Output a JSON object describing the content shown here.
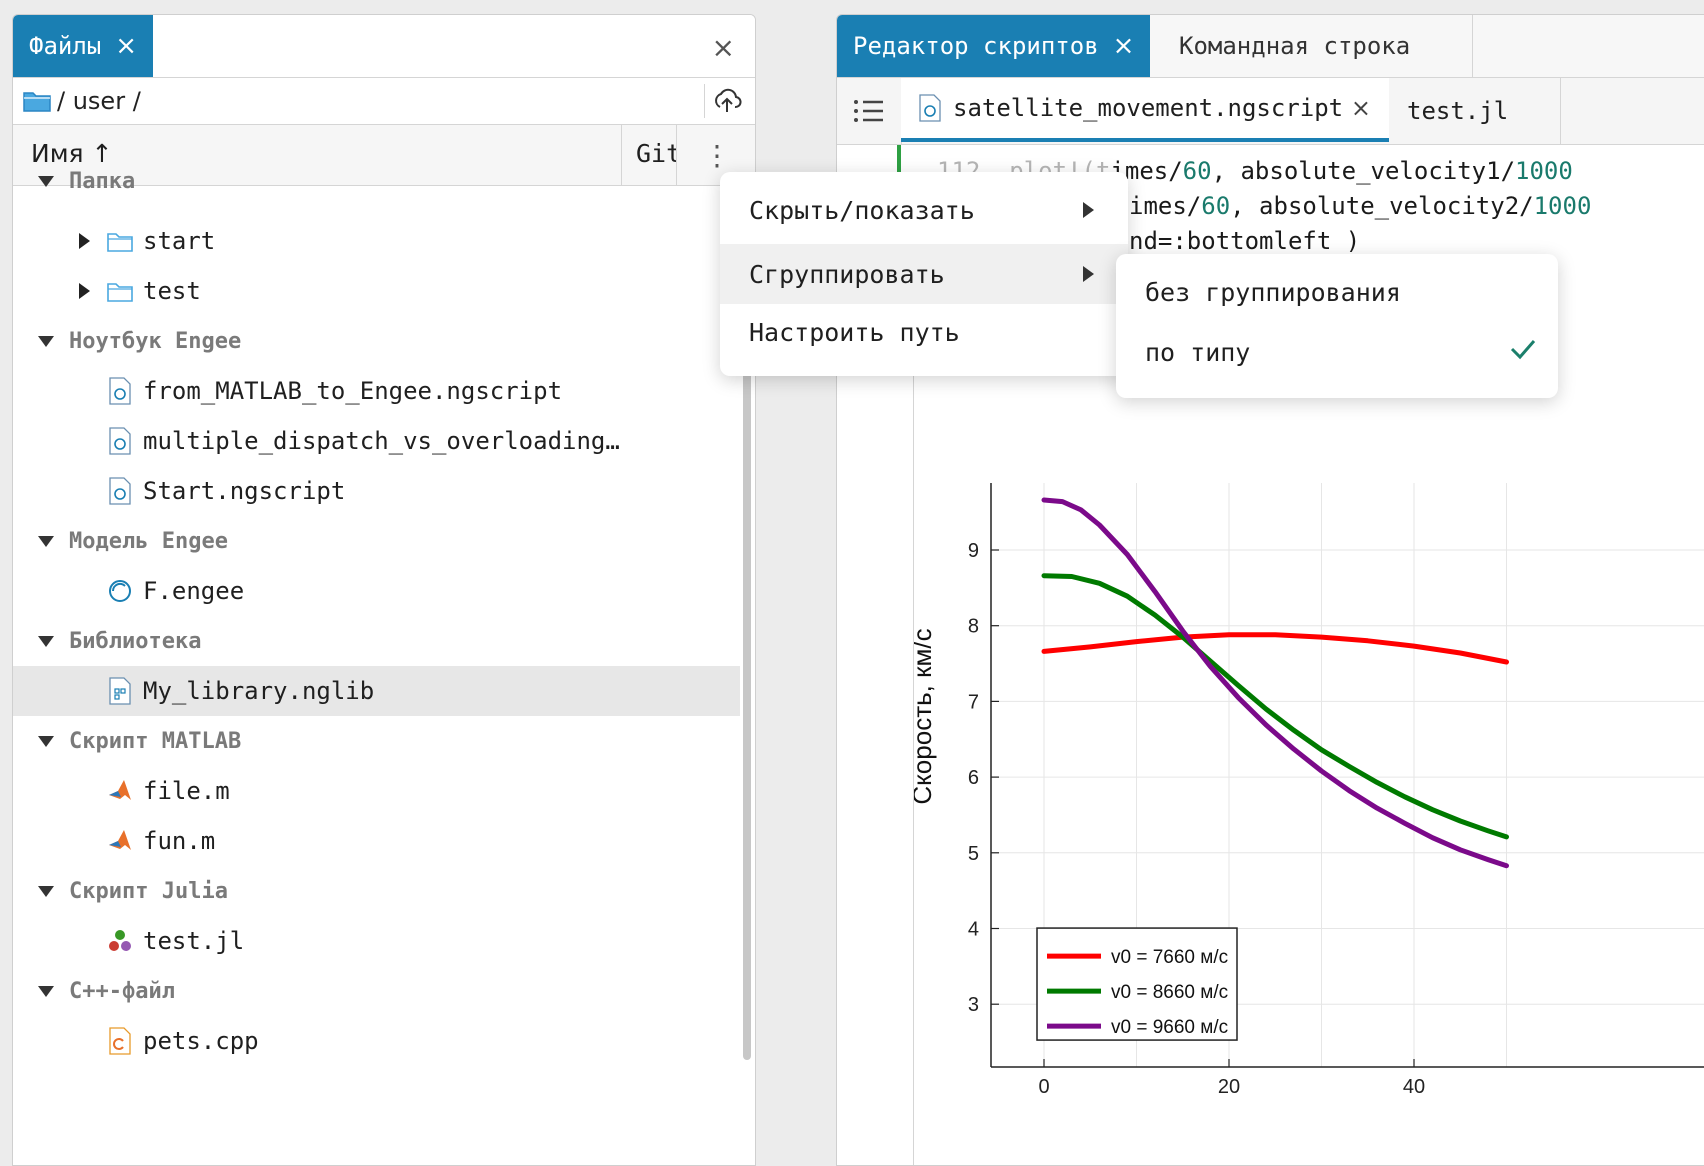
{
  "files_panel": {
    "tab_label": "Файлы",
    "close_glyph": "×",
    "path": "/ user /",
    "header_name": "Имя ↑",
    "header_git": "Git",
    "groups": [
      {
        "label": "Папка",
        "items": [
          "start",
          "test"
        ]
      },
      {
        "label": "Ноутбук Engee",
        "items": [
          "from_MATLAB_to_Engee.ngscript",
          "multiple_dispatch_vs_overloading…",
          "Start.ngscript"
        ]
      },
      {
        "label": "Модель Engee",
        "items": [
          "F.engee"
        ]
      },
      {
        "label": "Библиотека",
        "items": [
          "My_library.nglib"
        ]
      },
      {
        "label": "Скрипт MATLAB",
        "items": [
          "file.m",
          "fun.m"
        ]
      },
      {
        "label": "Скрипт Julia",
        "items": [
          "test.jl"
        ]
      },
      {
        "label": "C++-файл",
        "items": [
          "pets.cpp"
        ]
      }
    ]
  },
  "editor": {
    "tab_active": "Редактор скриптов",
    "tab_inactive": "Командная строка",
    "file_tab_active": "satellite_movement.ngscript",
    "file_tab_2": "test.jl",
    "code": {
      "l1_num": "112",
      "l1_a": "plot!(t",
      "l1_b": "imes/",
      "l1_c": "60",
      "l1_d": ", absolute_velocity1/",
      "l1_e": "1000",
      "l2_a": "imes/",
      "l2_b": "60",
      "l2_c": ", absolute_velocity2/",
      "l2_d": "1000",
      "l3": "nd=:bottomleft )"
    }
  },
  "context_menu": {
    "items": [
      "Скрыть/показать",
      "Сгруппировать",
      "Настроить путь"
    ],
    "submenu": [
      "без группирования",
      "по типу"
    ]
  },
  "colors": {
    "accent": "#1a7fb3",
    "check": "#1b7f6b"
  },
  "chart_data": {
    "type": "line",
    "title": "",
    "xlabel": "",
    "ylabel": "Скорость, км/с",
    "xlim": [
      0,
      60
    ],
    "ylim": [
      2.5,
      9.9
    ],
    "x_ticks": [
      0,
      20,
      40
    ],
    "y_ticks": [
      3,
      4,
      5,
      6,
      7,
      8,
      9
    ],
    "grid": true,
    "legend_position": "bottom-left",
    "series": [
      {
        "name": "v0 = 7660 м/с",
        "color": "#ff0000",
        "x": [
          0,
          5,
          10,
          15,
          20,
          25,
          30,
          35,
          40,
          45,
          50
        ],
        "y": [
          7.66,
          7.72,
          7.79,
          7.85,
          7.88,
          7.88,
          7.85,
          7.8,
          7.73,
          7.64,
          7.52
        ]
      },
      {
        "name": "v0 = 8660 м/с",
        "color": "#007a00",
        "x": [
          0,
          3,
          6,
          9,
          12,
          15,
          18,
          21,
          24,
          27,
          30,
          33,
          36,
          39,
          42,
          45,
          48,
          50
        ],
        "y": [
          8.66,
          8.65,
          8.56,
          8.39,
          8.14,
          7.85,
          7.53,
          7.21,
          6.9,
          6.62,
          6.36,
          6.14,
          5.93,
          5.74,
          5.57,
          5.42,
          5.29,
          5.21
        ]
      },
      {
        "name": "v0 = 9660 м/с",
        "color": "#7b0a8a",
        "x": [
          0,
          2,
          4,
          6,
          9,
          12,
          15,
          18,
          21,
          24,
          27,
          30,
          33,
          36,
          39,
          42,
          45,
          48,
          50
        ],
        "y": [
          9.66,
          9.64,
          9.53,
          9.33,
          8.94,
          8.45,
          7.93,
          7.46,
          7.05,
          6.69,
          6.37,
          6.08,
          5.82,
          5.59,
          5.39,
          5.2,
          5.04,
          4.91,
          4.83
        ]
      }
    ]
  }
}
